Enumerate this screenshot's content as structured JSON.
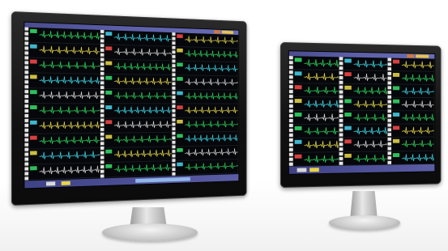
{
  "monitors": [
    {
      "name": "left-monitor",
      "columns": 3,
      "rows_per_column": 10
    },
    {
      "name": "right-monitor",
      "columns": 3,
      "rows_per_column": 8
    }
  ],
  "colors": {
    "screen_bg": "#05070a",
    "wave_green": "#2fd15b",
    "wave_cyan": "#3fd7e6",
    "wave_yellow": "#e6d64b",
    "wave_white": "#d9d9d9",
    "num_green": "#36e06a",
    "num_cyan": "#49d6f0",
    "num_red": "#ff4a4a",
    "num_yellow": "#f0dd4a",
    "topbar": "#5b5ea6",
    "bottombar": "#4f529a"
  },
  "icons": [
    "monitor-bezel",
    "ecg-waveform",
    "stand"
  ]
}
